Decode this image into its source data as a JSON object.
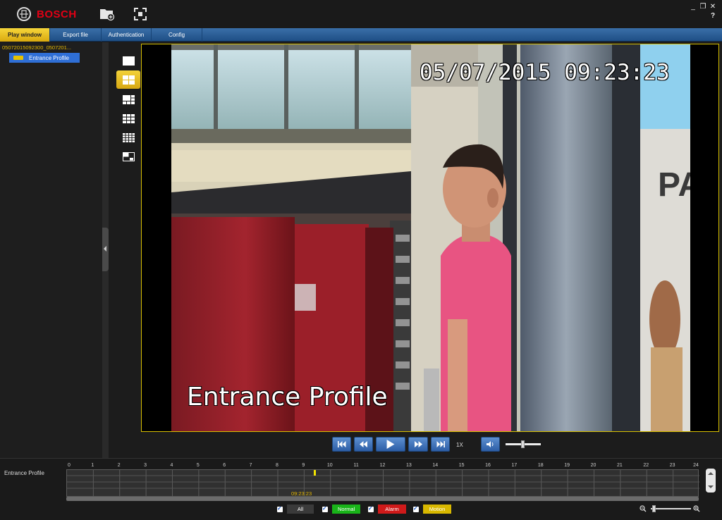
{
  "app": {
    "brand": "BOSCH"
  },
  "window": {
    "minimize": "_",
    "restore": "❐",
    "close": "✕",
    "help": "?"
  },
  "tabs": [
    {
      "label": "Play window",
      "active": true
    },
    {
      "label": "Export file"
    },
    {
      "label": "Authentication"
    },
    {
      "label": "Config"
    }
  ],
  "tree": {
    "root": "05072015092300_0507201...",
    "node": "Entrance Profile"
  },
  "video": {
    "timestamp": "05/07/2015  09:23:23",
    "camera_name": "Entrance Profile"
  },
  "playback": {
    "speed": "1X",
    "volume_level": 0.5
  },
  "timeline": {
    "channel_label": "Entrance Profile",
    "hours": [
      "0",
      "1",
      "2",
      "3",
      "4",
      "5",
      "6",
      "7",
      "8",
      "9",
      "10",
      "11",
      "12",
      "13",
      "14",
      "15",
      "16",
      "17",
      "18",
      "19",
      "20",
      "21",
      "22",
      "23",
      "24"
    ],
    "cursor_time": "09:23:23",
    "cursor_hour": 9.39
  },
  "legend": [
    {
      "label": "All",
      "color": "#3a3a3a"
    },
    {
      "label": "Normal",
      "color": "#19b419"
    },
    {
      "label": "Alarm",
      "color": "#d01a1a"
    },
    {
      "label": "Motion",
      "color": "#d8b800"
    }
  ],
  "zoom": {
    "level": 0.05
  }
}
